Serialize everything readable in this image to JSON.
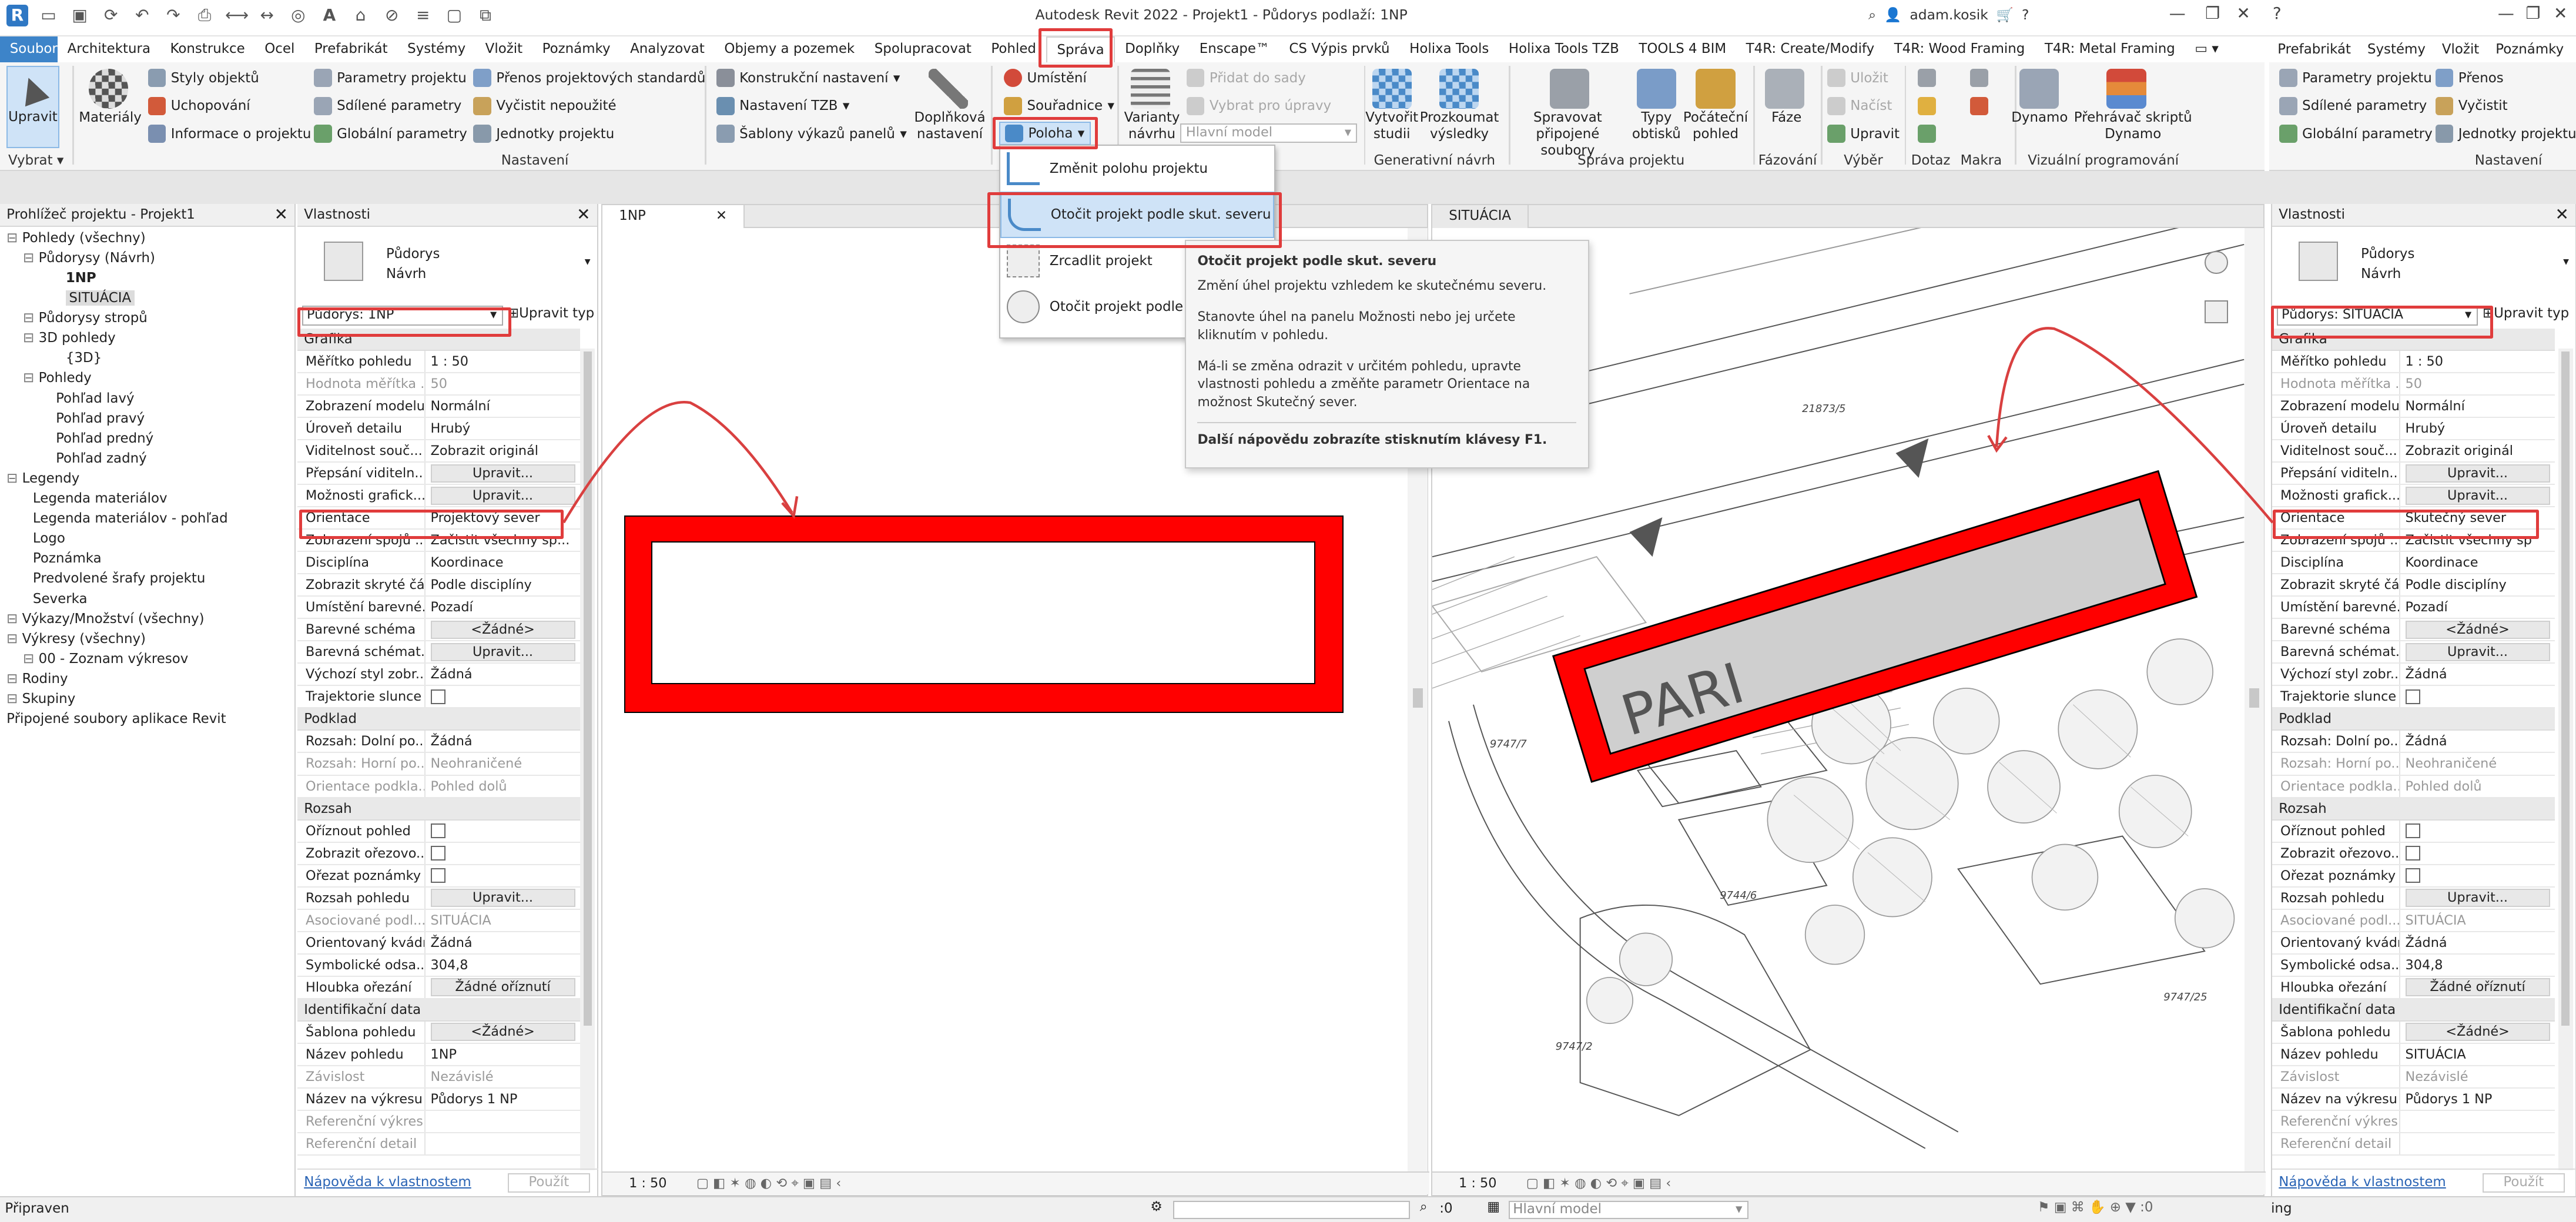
{
  "app": {
    "title": "Autodesk Revit 2022 - Projekt1 - Půdorys podlaží: 1NP",
    "user": "adam.kosik"
  },
  "tabs": [
    "Soubor",
    "Architektura",
    "Konstrukce",
    "Ocel",
    "Prefabrikát",
    "Systémy",
    "Vložit",
    "Poznámky",
    "Analyzovat",
    "Objemy a pozemek",
    "Spolupracovat",
    "Pohled",
    "Správa",
    "Doplňky",
    "Enscape™",
    "CS Výpis prvků",
    "Holixa Tools",
    "Holixa Tools TZB",
    "TOOLS 4 BIM",
    "T4R: Create/Modify",
    "T4R: Wood Framing",
    "T4R: Metal Framing"
  ],
  "right_tabs": [
    "Prefabrikát",
    "Systémy",
    "Vložit",
    "Poznámky"
  ],
  "ribbon": {
    "select": {
      "modify": "Upravit",
      "panel": "Vybrat"
    },
    "settings": {
      "materials": "Materiály",
      "object_styles": "Styly objektů",
      "snaps": "Uchopování",
      "project_info": "Informace o projektu",
      "project_params": "Parametry projektu",
      "shared_params": "Sdílené parametry",
      "global_params": "Globální parametry",
      "transfer": "Přenos projektových standardů",
      "purge": "Vyčistit nepoužité",
      "units": "Jednotky projektu",
      "structural": "Konstrukční nastavení",
      "mep": "Nastavení TZB",
      "templates": "Šablony výkazů panelů",
      "additional": "Doplňková nastavení",
      "panel": "Nastavení"
    },
    "location": {
      "place": "Umístění",
      "coords": "Souřadnice",
      "position": "Poloha"
    },
    "design_options": {
      "variants": "Varianty návrhu",
      "add_to_set": "Přidat do sady",
      "select_edit": "Vybrat pro úpravy",
      "main_model": "Hlavní model"
    },
    "generative": {
      "create": "Vytvořit studii",
      "explore": "Prozkoumat výsledky",
      "panel": "Generativní návrh"
    },
    "manage_project": {
      "manage_links": "Spravovat připojené soubory",
      "decal_types": "Typy obtisků",
      "starting_view": "Počáteční pohled",
      "panel": "Správa projektu"
    },
    "phasing": {
      "phases": "Fáze",
      "panel": "Fázování"
    },
    "selection": {
      "save": "Uložit",
      "load": "Načíst",
      "edit": "Upravit",
      "panel": "Výběr"
    },
    "inquiry": "Dotaz",
    "macros": "Makra",
    "visual": {
      "dynamo": "Dynamo",
      "player": "Přehrávač skriptů Dynamo",
      "panel": "Vizuální programování"
    },
    "right": {
      "project_params": "Parametry projektu",
      "shared_params": "Sdílené parametry",
      "global_params": "Globální parametry",
      "transfer": "Přenos",
      "purge": "Vyčistit",
      "units": "Jednotky projektu",
      "panel": "Nastavení"
    }
  },
  "dropdown": [
    "Změnit polohu projektu",
    "Otočit projekt podle skut. severu",
    "Zrcadlit projekt",
    "Otočit projekt podle p"
  ],
  "tooltip": {
    "title": "Otočit projekt podle skut. severu",
    "l1": "Změní úhel projektu vzhledem ke skutečnému severu.",
    "l2": "Stanovte úhel na panelu Možnosti nebo jej určete kliknutím v pohledu.",
    "l3": "Má-li se změna odrazit v určitém pohledu, upravte vlastnosti pohledu a změňte parametr Orientace na možnost Skutečný sever.",
    "l4": "Další nápovědu zobrazíte stisknutím klávesy F1."
  },
  "browser": {
    "title": "Prohlížeč projektu - Projekt1",
    "items": [
      "Pohledy (všechny)",
      "Půdorysy (Návrh)",
      "1NP",
      "SITUÁCIA",
      "Půdorysy stropů",
      "3D pohledy",
      "{3D}",
      "Pohledy",
      "Pohľad lavý",
      "Pohľad pravý",
      "Pohľad predný",
      "Pohľad zadný",
      "Legendy",
      "Legenda materiálov",
      "Legenda materiálov - pohľad",
      "Logo",
      "Poznámka",
      "Predvolené šrafy projektu",
      "Severka",
      "Výkazy/Množství (všechny)",
      "Výkresy (všechny)",
      "00 - Zoznam výkresov",
      "Rodiny",
      "Skupiny",
      "Připojené soubory aplikace Revit"
    ]
  },
  "props_left": {
    "title": "Vlastnosti",
    "type": "Půdorys",
    "type2": "Návrh",
    "selector": "Půdorys: 1NP",
    "edit_type": "Upravit typ",
    "help": "Nápověda k vlastnostem",
    "apply": "Použít",
    "rows": [
      [
        "s",
        "Grafika"
      ],
      [
        "r",
        "Měřítko pohledu",
        "1 : 50"
      ],
      [
        "g",
        "Hodnota měřítka ...",
        "50"
      ],
      [
        "r",
        "Zobrazení modelu",
        "Normální"
      ],
      [
        "r",
        "Úroveň detailu",
        "Hrubý"
      ],
      [
        "r",
        "Viditelnost souč...",
        "Zobrazit originál"
      ],
      [
        "b",
        "Přepsání viditeln...",
        "Upravit..."
      ],
      [
        "b",
        "Možnosti grafick...",
        "Upravit..."
      ],
      [
        "r",
        "Orientace",
        "Projektový sever"
      ],
      [
        "r",
        "Zobrazení spojů ...",
        "Začistit všechny sp..."
      ],
      [
        "r",
        "Disciplína",
        "Koordinace"
      ],
      [
        "r",
        "Zobrazit skryté čá...",
        "Podle disciplíny"
      ],
      [
        "r",
        "Umístění barevné...",
        "Pozadí"
      ],
      [
        "b",
        "Barevné schéma",
        "<Žádné>"
      ],
      [
        "b",
        "Barevná schémat...",
        "Upravit..."
      ],
      [
        "r",
        "Výchozí styl zobr...",
        "Žádná"
      ],
      [
        "c",
        "Trajektorie slunce",
        ""
      ],
      [
        "s",
        "Podklad"
      ],
      [
        "r",
        "Rozsah: Dolní po...",
        "Žádná"
      ],
      [
        "g",
        "Rozsah: Horní po...",
        "Neohraničené"
      ],
      [
        "g",
        "Orientace podkla...",
        "Pohled dolů"
      ],
      [
        "s",
        "Rozsah"
      ],
      [
        "c",
        "Oříznout pohled",
        ""
      ],
      [
        "c",
        "Zobrazit ořezovo...",
        ""
      ],
      [
        "c",
        "Ořezat poznámky",
        ""
      ],
      [
        "b",
        "Rozsah pohledu",
        "Upravit..."
      ],
      [
        "g",
        "Asociované podl...",
        "SITUÁCIA"
      ],
      [
        "r",
        "Orientovaný kvádr",
        "Žádná"
      ],
      [
        "r",
        "Symbolické odsa...",
        "304,8"
      ],
      [
        "b",
        "Hloubka ořezání",
        "Žádné oříznutí"
      ],
      [
        "s",
        "Identifikační data"
      ],
      [
        "b",
        "Šablona pohledu",
        "<Žádné>"
      ],
      [
        "r",
        "Název pohledu",
        "1NP"
      ],
      [
        "g",
        "Závislost",
        "Nezávislé"
      ],
      [
        "r",
        "Název na výkresu",
        "Půdorys 1 NP"
      ],
      [
        "g",
        "Referenční výkres",
        ""
      ],
      [
        "g",
        "Referenční detail",
        ""
      ]
    ]
  },
  "props_right": {
    "title": "Vlastnosti",
    "type": "Půdorys",
    "type2": "Návrh",
    "selector": "Půdorys: SITUÁCIA",
    "edit_type": "Upravit typ",
    "help": "Nápověda k vlastnostem",
    "apply": "Použít",
    "rows": [
      [
        "s",
        "Grafika"
      ],
      [
        "r",
        "Měřítko pohledu",
        "1 : 50"
      ],
      [
        "g",
        "Hodnota měřítka ...",
        "50"
      ],
      [
        "r",
        "Zobrazení modelu",
        "Normální"
      ],
      [
        "r",
        "Úroveň detailu",
        "Hrubý"
      ],
      [
        "r",
        "Viditelnost souč...",
        "Zobrazit originál"
      ],
      [
        "b",
        "Přepsání viditeln...",
        "Upravit..."
      ],
      [
        "b",
        "Možnosti grafick...",
        "Upravit..."
      ],
      [
        "r",
        "Orientace",
        "Skutečný sever"
      ],
      [
        "r",
        "Zobrazení spojů ...",
        "Začistit všechny sp"
      ],
      [
        "r",
        "Disciplína",
        "Koordinace"
      ],
      [
        "r",
        "Zobrazit skryté čá...",
        "Podle disciplíny"
      ],
      [
        "r",
        "Umístění barevné...",
        "Pozadí"
      ],
      [
        "b",
        "Barevné schéma",
        "<Žádné>"
      ],
      [
        "b",
        "Barevná schémat...",
        "Upravit..."
      ],
      [
        "r",
        "Výchozí styl zobr...",
        "Žádná"
      ],
      [
        "c",
        "Trajektorie slunce",
        ""
      ],
      [
        "s",
        "Podklad"
      ],
      [
        "r",
        "Rozsah: Dolní po...",
        "Žádná"
      ],
      [
        "g",
        "Rozsah: Horní po...",
        "Neohraničené"
      ],
      [
        "g",
        "Orientace podkla...",
        "Pohled dolů"
      ],
      [
        "s",
        "Rozsah"
      ],
      [
        "c",
        "Oříznout pohled",
        ""
      ],
      [
        "c",
        "Zobrazit ořezovo...",
        ""
      ],
      [
        "c",
        "Ořezat poznámky",
        ""
      ],
      [
        "b",
        "Rozsah pohledu",
        "Upravit..."
      ],
      [
        "g",
        "Asociované podl...",
        "SITUÁCIA"
      ],
      [
        "r",
        "Orientovaný kvádr",
        "Žádná"
      ],
      [
        "r",
        "Symbolické odsa...",
        "304,8"
      ],
      [
        "b",
        "Hloubka ořezání",
        "Žádné oříznutí"
      ],
      [
        "s",
        "Identifikační data"
      ],
      [
        "b",
        "Šablona pohledu",
        "<Žádné>"
      ],
      [
        "r",
        "Název pohledu",
        "SITUÁCIA"
      ],
      [
        "g",
        "Závislost",
        "Nezávislé"
      ],
      [
        "r",
        "Název na výkresu",
        "Půdorys 1 NP"
      ],
      [
        "g",
        "Referenční výkres",
        ""
      ],
      [
        "g",
        "Referenční detail",
        ""
      ]
    ]
  },
  "views": {
    "left": "1NP",
    "right": "SITUÁCIA",
    "scale": "1 : 50",
    "site_label": "PARI",
    "parcels": [
      "21873/5",
      "9747/7",
      "9744/6",
      "9747/25",
      "9747/2"
    ]
  },
  "status": {
    "left": "Připraven",
    "coord": ":0",
    "model": "Hlavní model",
    "right": "ing"
  },
  "colors": {
    "accent": "#3d84c9",
    "highlight": "#e03c3c",
    "building": "#ff0000"
  }
}
